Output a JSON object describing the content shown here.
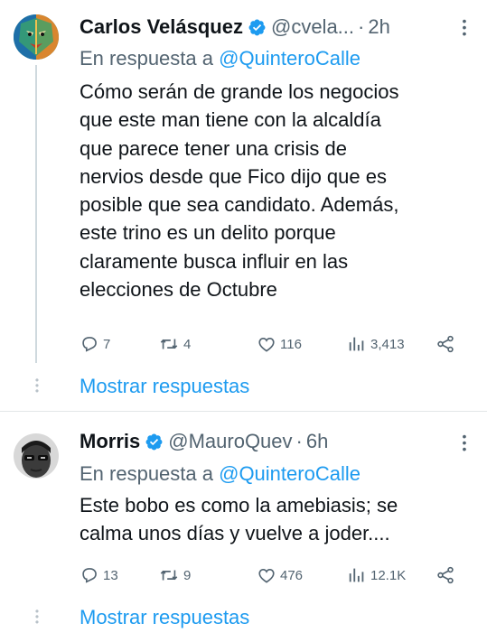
{
  "tweets": [
    {
      "author_name": "Carlos Velásquez",
      "handle": "@cvela...",
      "separator": "·",
      "time": "2h",
      "reply_prefix": "En respuesta a",
      "reply_mention": "@QuinteroCalle",
      "text_lines": [
        "Cómo serán de grande los negocios",
        "que este man tiene con la alcaldía",
        "que parece tener una crisis de",
        "nervios desde que Fico dijo que es",
        "posible que sea candidato. Además,",
        "este trino es un delito porque",
        "claramente busca influir en las",
        "elecciones de Octubre"
      ],
      "stats": {
        "replies": "7",
        "retweets": "4",
        "likes": "116",
        "views": "3,413"
      },
      "show_replies": "Mostrar respuestas"
    },
    {
      "author_name": "Morris",
      "handle": "@MauroQuev",
      "separator": "·",
      "time": "6h",
      "reply_prefix": "En respuesta a",
      "reply_mention": "@QuinteroCalle",
      "text_lines": [
        "Este bobo es como la amebiasis; se",
        "calma unos días y vuelve a joder...."
      ],
      "stats": {
        "replies": "13",
        "retweets": "9",
        "likes": "476",
        "views": "12.1K"
      },
      "show_replies": "Mostrar respuestas"
    }
  ],
  "colors": {
    "link": "#1d9bf0",
    "secondary_text": "#536471",
    "verified": "#1d9bf0",
    "thread_line": "#cfd9de"
  },
  "icons": [
    "reply-icon",
    "retweet-icon",
    "like-icon",
    "views-icon",
    "share-icon",
    "verified-badge-icon",
    "more-icon"
  ]
}
